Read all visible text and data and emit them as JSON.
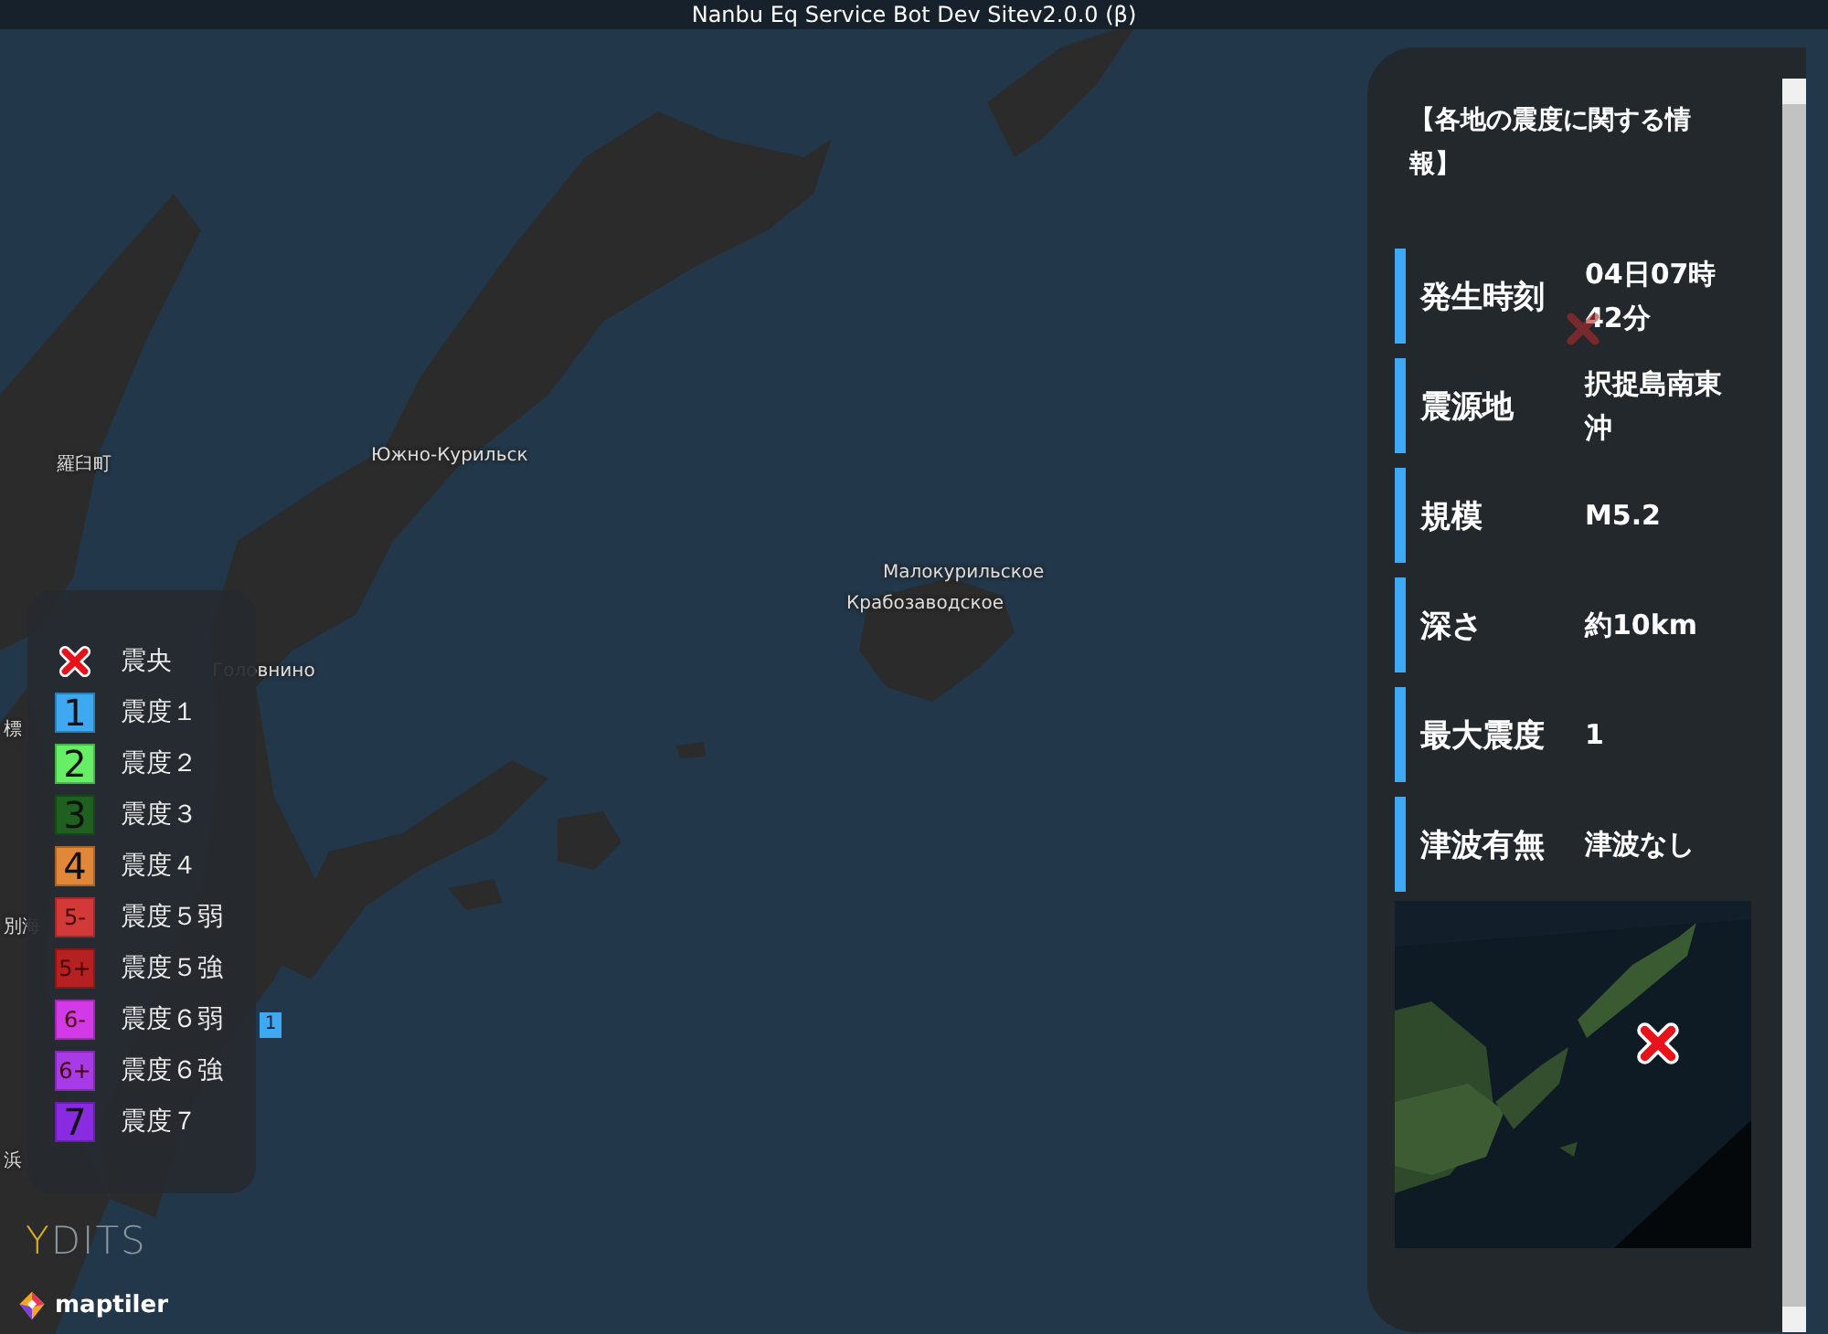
{
  "window": {
    "title": "Nanbu Eq Service Bot Dev Sitev2.0.0 (β)"
  },
  "map": {
    "labels": [
      {
        "text": "羅臼町"
      },
      {
        "text": "Южно-Курильск"
      },
      {
        "text": "Малокурильское"
      },
      {
        "text": "Крабозаводское"
      },
      {
        "text": "Головнино"
      },
      {
        "text": "標"
      },
      {
        "text": "別海"
      },
      {
        "text": "浜"
      }
    ],
    "station_marker": {
      "label": "1",
      "color": "#3ea8f0"
    }
  },
  "legend": {
    "items": [
      {
        "kind": "epicenter",
        "label": "震央"
      },
      {
        "kind": "intensity",
        "symbol": "1",
        "label": "震度１",
        "color": "#3ea8f0"
      },
      {
        "kind": "intensity",
        "symbol": "2",
        "label": "震度２",
        "color": "#66ee66"
      },
      {
        "kind": "intensity",
        "symbol": "3",
        "label": "震度３",
        "color": "#1f5f1f"
      },
      {
        "kind": "intensity",
        "symbol": "4",
        "label": "震度４",
        "color": "#e0873a"
      },
      {
        "kind": "intensity",
        "symbol": "5-",
        "label": "震度５弱",
        "color": "#d23a3a"
      },
      {
        "kind": "intensity",
        "symbol": "5+",
        "label": "震度５強",
        "color": "#b52020"
      },
      {
        "kind": "intensity",
        "symbol": "6-",
        "label": "震度６弱",
        "color": "#d23ae8"
      },
      {
        "kind": "intensity",
        "symbol": "6+",
        "label": "震度６強",
        "color": "#a83ae8"
      },
      {
        "kind": "intensity",
        "symbol": "7",
        "label": "震度７",
        "color": "#8a2be2"
      }
    ]
  },
  "logos": {
    "ydits": {
      "accent": "Y",
      "rest": "DITS"
    },
    "maptiler": "maptiler"
  },
  "panel": {
    "heading": "【各地の震度に関する情報】",
    "rows": [
      {
        "label": "発生時刻",
        "value": "04日07時42分"
      },
      {
        "label": "震源地",
        "value": "択捉島南東沖"
      },
      {
        "label": "規模",
        "value": "M5.2"
      },
      {
        "label": "深さ",
        "value": "約10km"
      },
      {
        "label": "最大震度",
        "value": "1"
      },
      {
        "label": "津波有無",
        "value": "津波なし"
      }
    ]
  }
}
